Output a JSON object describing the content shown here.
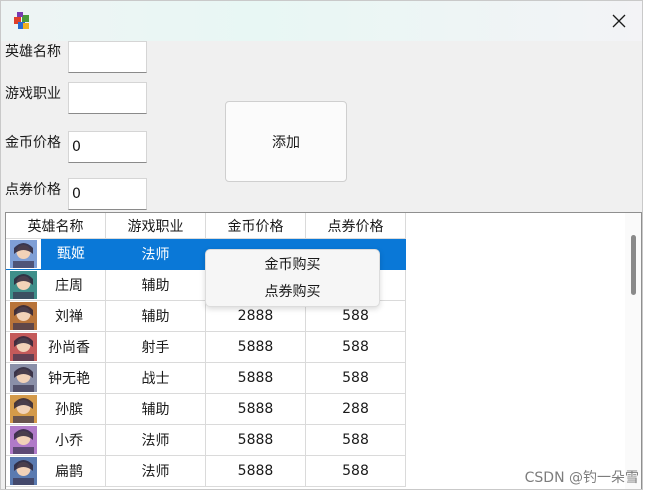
{
  "window": {
    "title": "",
    "close_glyph": "✕"
  },
  "form": {
    "hero_name": {
      "label": "英雄名称",
      "value": ""
    },
    "hero_role": {
      "label": "游戏职业",
      "value": ""
    },
    "gold_price": {
      "label": "金币价格",
      "value": "0"
    },
    "coupon_price": {
      "label": "点券价格",
      "value": "0"
    },
    "add_button": "添加"
  },
  "grid": {
    "columns": [
      "英雄名称",
      "游戏职业",
      "金币价格",
      "点券价格"
    ],
    "rows": [
      {
        "name": "甄姬",
        "role": "法师",
        "gold": "",
        "coupon": "",
        "selected": true,
        "avatar": "zhenji-avatar"
      },
      {
        "name": "庄周",
        "role": "辅助",
        "gold": "",
        "coupon": "",
        "selected": false,
        "avatar": "zhuangzhou-avatar"
      },
      {
        "name": "刘禅",
        "role": "辅助",
        "gold": "2888",
        "coupon": "588",
        "selected": false,
        "avatar": "liushan-avatar"
      },
      {
        "name": "孙尚香",
        "role": "射手",
        "gold": "5888",
        "coupon": "588",
        "selected": false,
        "avatar": "sunshangxiang-avatar"
      },
      {
        "name": "钟无艳",
        "role": "战士",
        "gold": "5888",
        "coupon": "588",
        "selected": false,
        "avatar": "zhongwuyan-avatar"
      },
      {
        "name": "孙膑",
        "role": "辅助",
        "gold": "5888",
        "coupon": "288",
        "selected": false,
        "avatar": "sunbin-avatar"
      },
      {
        "name": "小乔",
        "role": "法师",
        "gold": "5888",
        "coupon": "588",
        "selected": false,
        "avatar": "xiaoqiao-avatar"
      },
      {
        "name": "扁鹊",
        "role": "法师",
        "gold": "5888",
        "coupon": "588",
        "selected": false,
        "avatar": "bianque-avatar"
      }
    ]
  },
  "context_menu": {
    "items": [
      "金币购买",
      "点券购买"
    ]
  },
  "watermark": "CSDN @钓一朵雪",
  "colors": {
    "selection": "#0a78d7",
    "avatar_tints": [
      "#7f9fd6",
      "#3f8f8a",
      "#b8743a",
      "#c45a5a",
      "#8a8fa8",
      "#d49a4a",
      "#b07ac8",
      "#5a7ab0"
    ]
  }
}
